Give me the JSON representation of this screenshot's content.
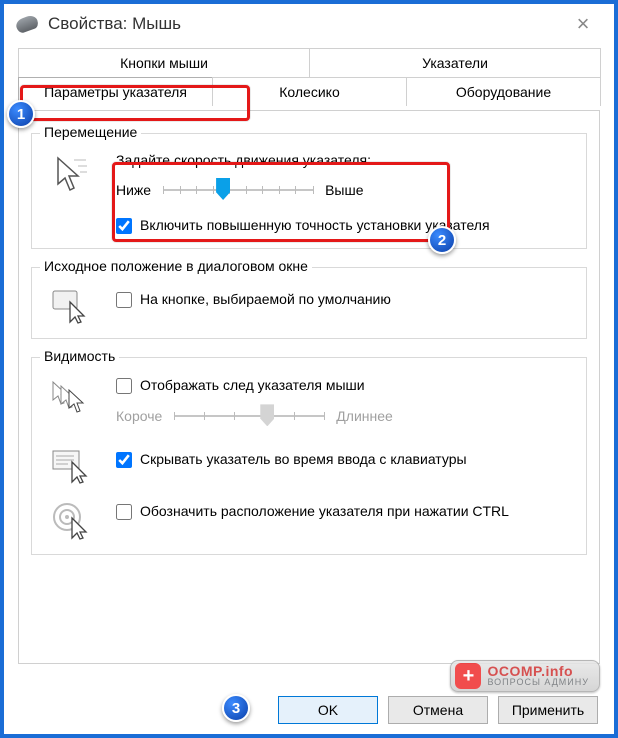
{
  "window": {
    "title": "Свойства: Мышь"
  },
  "tabs": {
    "row1": [
      "Кнопки мыши",
      "Указатели"
    ],
    "row2": [
      "Параметры указателя",
      "Колесико",
      "Оборудование"
    ],
    "active": "Параметры указателя"
  },
  "groups": {
    "motion": {
      "legend": "Перемещение",
      "speed_label": "Задайте скорость движения указателя:",
      "slow": "Ниже",
      "fast": "Выше",
      "enhance": "Включить повышенную точность установки указателя",
      "enhance_checked": true
    },
    "snap": {
      "legend": "Исходное положение в диалоговом окне",
      "snap_label": "На кнопке, выбираемой по умолчанию",
      "snap_checked": false
    },
    "visibility": {
      "legend": "Видимость",
      "trails_label": "Отображать след указателя мыши",
      "trails_checked": false,
      "short": "Короче",
      "long": "Длиннее",
      "hide_label": "Скрывать указатель во время ввода с клавиатуры",
      "hide_checked": true,
      "ctrl_label": "Обозначить расположение указателя при нажатии CTRL",
      "ctrl_checked": false
    }
  },
  "buttons": {
    "ok": "OK",
    "cancel": "Отмена",
    "apply": "Применить"
  },
  "annotations": {
    "b1": "1",
    "b2": "2",
    "b3": "3"
  },
  "watermark": {
    "brand": "OCOMP",
    "tld": ".info",
    "sub": "ВОПРОСЫ АДМИНУ"
  }
}
